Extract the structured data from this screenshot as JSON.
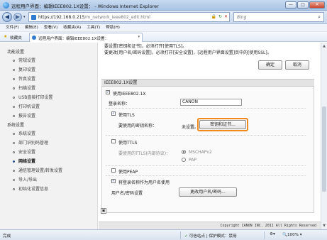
{
  "window": {
    "title": "远程用户界面：编辑IEEE802.1X设置：                    - Windows Internet Explorer",
    "min": "—",
    "max": "□",
    "close": "✕"
  },
  "address": {
    "url_main": "https://192.168.0.215",
    "url_path": "/m_network_ieee802_edit.html",
    "search_placeholder": "Bing"
  },
  "menu": [
    "文件(F)",
    "编辑(E)",
    "查看(V)",
    "收藏夹(A)",
    "工具(T)",
    "帮助(H)"
  ],
  "favorites": {
    "label": "收藏夹",
    "tab_title": "远程用户界面：编辑IEEE802.1X设置："
  },
  "sidebar": {
    "group1": "功能设置",
    "group1_items": [
      "常规设置",
      "复印设置",
      "传真设置",
      "扫描设置",
      "USB直接打印设置",
      "打印机设置",
      "报告设置"
    ],
    "group2": "系统设置",
    "group2_items": [
      "系统设置",
      "部门识别码管理",
      "安全设置",
      "网络设置",
      "通信管理设置/转发设置",
      "导入/导出",
      "初始化设置信息"
    ],
    "active": "网络设置"
  },
  "main": {
    "notice_line1": "要设置[密钥和证书]，必须打开[使用TLS]。",
    "notice_line2": "要更改[用户名/密码设置]，必须打开[安全设置]，[远程用户界面设置]页中的[使用SSL]。",
    "ok": "确定",
    "cancel": "取消",
    "section_title": "IEEE802.1X设置",
    "use_ieee": "使用IEEE802.1X",
    "login_name_label": "登录名称：",
    "login_name_value": "CANON",
    "use_tls": "使用TLS",
    "key_label": "要使用的密钥名称：",
    "key_value": "未设置。",
    "key_button": "密钥和证书...",
    "use_ttls": "使用TTLS",
    "ttls_inner_label": "要使用的TTLS(内部协议)：",
    "mschap": "MSCHAPv2",
    "pap": "PAP",
    "use_peap": "使用PEAP",
    "use_login_as_user": "将登录名称作为用户名使用",
    "user_pwd_label": "用户名/密码设置",
    "change_btn": "更改用户名/密码...",
    "copyright": "Copyright CANON INC. 2011 All Rights Reserved"
  },
  "status": {
    "left": "完成",
    "zone": "可信站点 | 保护模式：禁用",
    "zoom": "100%"
  }
}
